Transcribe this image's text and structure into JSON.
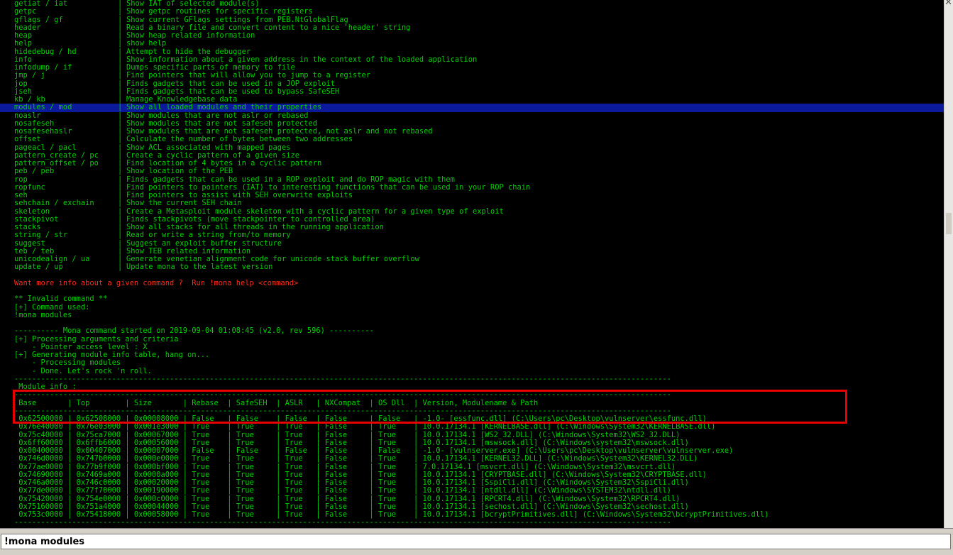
{
  "help_commands": [
    {
      "cmd": "getiat / iat",
      "desc": "Show IAT of selected module(s)"
    },
    {
      "cmd": "getpc",
      "desc": "Show getpc routines for specific registers"
    },
    {
      "cmd": "gflags / gf",
      "desc": "Show current GFlags settings from PEB.NtGlobalFlag"
    },
    {
      "cmd": "header",
      "desc": "Read a binary file and convert content to a nice 'header' string"
    },
    {
      "cmd": "heap",
      "desc": "Show heap related information"
    },
    {
      "cmd": "help",
      "desc": "show help"
    },
    {
      "cmd": "hidedebug / hd",
      "desc": "Attempt to hide the debugger"
    },
    {
      "cmd": "info",
      "desc": "Show information about a given address in the context of the loaded application"
    },
    {
      "cmd": "infodump / if",
      "desc": "Dumps specific parts of memory to file"
    },
    {
      "cmd": "jmp / j",
      "desc": "Find pointers that will allow you to jump to a register"
    },
    {
      "cmd": "jop",
      "desc": "Finds gadgets that can be used in a JOP exploit"
    },
    {
      "cmd": "jseh",
      "desc": "Finds gadgets that can be used to bypass SafeSEH"
    },
    {
      "cmd": "kb / kb",
      "desc": "Manage Knowledgebase data"
    },
    {
      "cmd": "modules / mod",
      "desc": "Show all loaded modules and their properties",
      "selected": true
    },
    {
      "cmd": "noaslr",
      "desc": "Show modules that are not aslr or rebased"
    },
    {
      "cmd": "nosafeseh",
      "desc": "Show modules that are not safeseh protected"
    },
    {
      "cmd": "nosafesehaslr",
      "desc": "Show modules that are not safeseh protected, not aslr and not rebased"
    },
    {
      "cmd": "offset",
      "desc": "Calculate the number of bytes between two addresses"
    },
    {
      "cmd": "pageacl / pacl",
      "desc": "Show ACL associated with mapped pages"
    },
    {
      "cmd": "pattern_create / pc",
      "desc": "Create a cyclic pattern of a given size"
    },
    {
      "cmd": "pattern_offset / po",
      "desc": "Find location of 4 bytes in a cyclic pattern"
    },
    {
      "cmd": "peb / peb",
      "desc": "Show location of the PEB"
    },
    {
      "cmd": "rop",
      "desc": "Finds gadgets that can be used in a ROP exploit and do ROP magic with them"
    },
    {
      "cmd": "ropfunc",
      "desc": "Find pointers to pointers (IAT) to interesting functions that can be used in your ROP chain"
    },
    {
      "cmd": "seh",
      "desc": "Find pointers to assist with SEH overwrite exploits"
    },
    {
      "cmd": "sehchain / exchain",
      "desc": "Show the current SEH chain"
    },
    {
      "cmd": "skeleton",
      "desc": "Create a Metasploit module skeleton with a cyclic pattern for a given type of exploit"
    },
    {
      "cmd": "stackpivot",
      "desc": "Finds stackpivots (move stackpointer to controlled area)"
    },
    {
      "cmd": "stacks",
      "desc": "Show all stacks for all threads in the running application"
    },
    {
      "cmd": "string / str",
      "desc": "Read or write a string from/to memory"
    },
    {
      "cmd": "suggest",
      "desc": "Suggest an exploit buffer structure"
    },
    {
      "cmd": "teb / teb",
      "desc": "Show TEB related information"
    },
    {
      "cmd": "unicodealign / ua",
      "desc": "Generate venetian alignment code for unicode stack buffer overflow"
    },
    {
      "cmd": "update / up",
      "desc": "Update mona to the latest version"
    }
  ],
  "hint_text": "Want more info about a given command ?  Run !mona help <command>",
  "invalid_lines": [
    "** Invalid command **",
    "[+] Command used:",
    "!mona modules"
  ],
  "run_lines": [
    "---------- Mona command started on 2019-09-04 01:08:45 (v2.0, rev 596) ----------",
    "[+] Processing arguments and criteria",
    "    - Pointer access level : X",
    "[+] Generating module info table, hang on...",
    "    - Processing modules",
    "    - Done. Let's rock 'n roll."
  ],
  "table": {
    "title": " Module info :",
    "headers": [
      "Base",
      "Top",
      "Size",
      "Rebase",
      "SafeSEH",
      "ASLR",
      "NXCompat",
      "OS Dll",
      "Version, Modulename & Path"
    ],
    "rows": [
      [
        "0x62500000",
        "0x62508000",
        "0x00008000",
        "False",
        "False",
        "False",
        "False",
        "False",
        "-1.0- [essfunc.dll] (C:\\Users\\pc\\Desktop\\vulnserver\\essfunc.dll)"
      ],
      [
        "0x76e40000",
        "0x76e03000",
        "0x001e3000",
        "True",
        "True",
        "True",
        "False",
        "True",
        "10.0.17134.1 [KERNELBASE.dll] (C:\\Windows\\System32\\KERNELBASE.dll)"
      ],
      [
        "0x75c40000",
        "0x75ca7000",
        "0x00067000",
        "True",
        "True",
        "True",
        "False",
        "True",
        "10.0.17134.1 [WS2_32.DLL] (C:\\Windows\\System32\\WS2_32.DLL)"
      ],
      [
        "0x6ff60000",
        "0x6ffb6000",
        "0x00056000",
        "True",
        "True",
        "True",
        "False",
        "True",
        "10.0.17134.1 [mswsock.dll] (C:\\Windows\\system32\\mswsock.dll)"
      ],
      [
        "0x00400000",
        "0x00407000",
        "0x00007000",
        "False",
        "False",
        "False",
        "False",
        "False",
        "-1.0- [vulnserver.exe] (C:\\Users\\pc\\Desktop\\vulnserver\\vulnserver.exe)"
      ],
      [
        "0x746d0000",
        "0x747b0000",
        "0x000e0000",
        "True",
        "True",
        "True",
        "False",
        "True",
        "10.0.17134.1 [KERNEL32.DLL] (C:\\Windows\\System32\\KERNEL32.DLL)"
      ],
      [
        "0x77ae0000",
        "0x77b9f000",
        "0x000bf000",
        "True",
        "True",
        "True",
        "False",
        "True",
        "7.0.17134.1 [msvcrt.dll] (C:\\Windows\\System32\\msvcrt.dll)"
      ],
      [
        "0x74690000",
        "0x7469a000",
        "0x0000a000",
        "True",
        "True",
        "True",
        "False",
        "True",
        "10.0.17134.1 [CRYPTBASE.dll] (C:\\Windows\\System32\\CRYPTBASE.dll)"
      ],
      [
        "0x746a0000",
        "0x746c0000",
        "0x00020000",
        "True",
        "True",
        "True",
        "False",
        "True",
        "10.0.17134.1 [SspiCli.dll] (C:\\Windows\\System32\\SspiCli.dll)"
      ],
      [
        "0x77de0000",
        "0x77f70000",
        "0x00190000",
        "True",
        "True",
        "True",
        "False",
        "True",
        "10.0.17134.1 [ntdll.dll] (C:\\Windows\\SYSTEM32\\ntdll.dll)"
      ],
      [
        "0x75420000",
        "0x754e0000",
        "0x000c0000",
        "True",
        "True",
        "True",
        "False",
        "True",
        "10.0.17134.1 [RPCRT4.dll] (C:\\Windows\\System32\\RPCRT4.dll)"
      ],
      [
        "0x75160000",
        "0x751a4000",
        "0x00044000",
        "True",
        "True",
        "True",
        "False",
        "True",
        "10.0.17134.1 [sechost.dll] (C:\\Windows\\System32\\sechost.dll)"
      ],
      [
        "0x753c0000",
        "0x75418000",
        "0x00058000",
        "True",
        "True",
        "True",
        "False",
        "True",
        "10.0.17134.1 [bcryptPrimitives.dll] (C:\\Windows\\System32\\bcryptPrimitives.dll)"
      ]
    ]
  },
  "command_input": "!mona modules",
  "colors": {
    "console_bg": "#000000",
    "text_green": "#00d000",
    "text_red": "#ff2a1a",
    "selection": "#0a1a9a",
    "highlight_box": "#e80000"
  }
}
